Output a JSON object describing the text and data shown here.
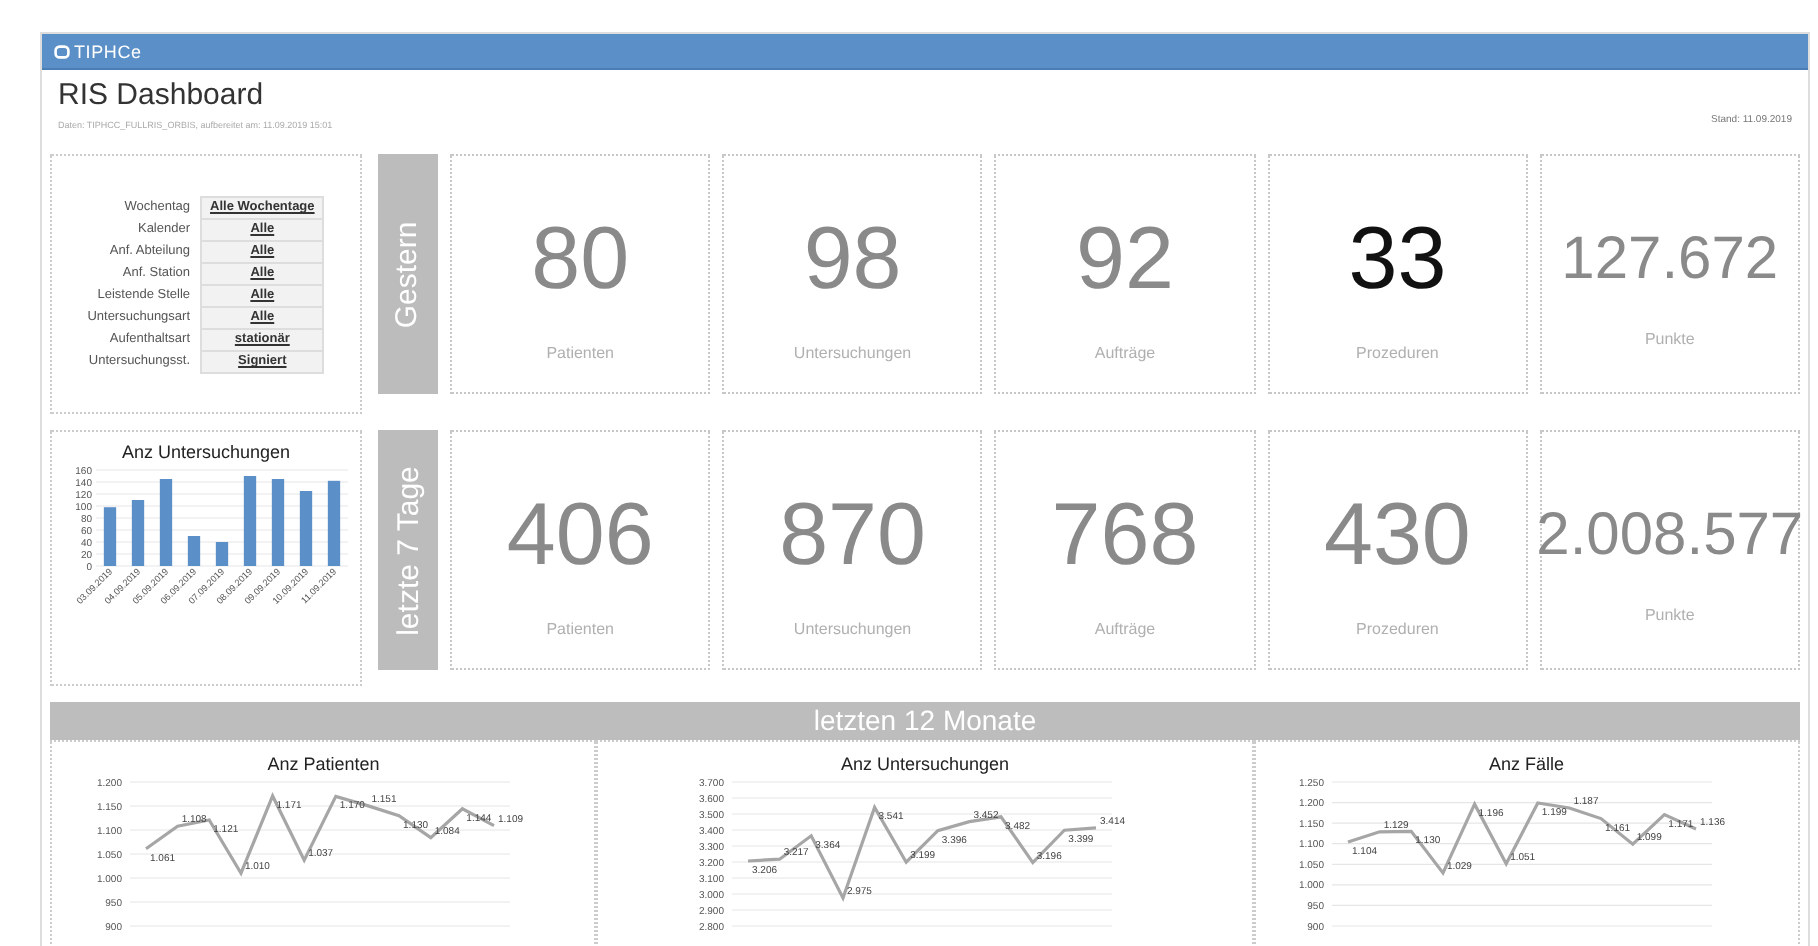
{
  "header": {
    "logo": "TIPHCe"
  },
  "title": "RIS Dashboard",
  "subtitle": "Daten: TIPHCC_FULLRIS_ORBIS, aufbereitet am: 11.09.2019 15:01",
  "stand": "Stand:  11.09.2019",
  "filters": [
    {
      "label": "Wochentag",
      "value": "Alle Wochentage"
    },
    {
      "label": "Kalender",
      "value": "Alle"
    },
    {
      "label": "Anf. Abteilung",
      "value": "Alle"
    },
    {
      "label": "Anf. Station",
      "value": "Alle"
    },
    {
      "label": "Leistende Stelle",
      "value": "Alle"
    },
    {
      "label": "Untersuchungsart",
      "value": "Alle"
    },
    {
      "label": "Aufenthaltsart",
      "value": "stationär"
    },
    {
      "label": "Untersuchungsst.",
      "value": "Signiert"
    }
  ],
  "gestern": {
    "label": "Gestern",
    "kpis": [
      {
        "value": "80",
        "label": "Patienten",
        "highlight": false
      },
      {
        "value": "98",
        "label": "Untersuchungen",
        "highlight": false
      },
      {
        "value": "92",
        "label": "Aufträge",
        "highlight": false
      },
      {
        "value": "33",
        "label": "Prozeduren",
        "highlight": true
      },
      {
        "value": "127.672",
        "label": "Punkte",
        "highlight": false
      }
    ]
  },
  "bar_chart": {
    "chart_data": {
      "type": "bar",
      "title": "Anz Untersuchungen",
      "categories": [
        "03.09.2019",
        "04.09.2019",
        "05.09.2019",
        "06.09.2019",
        "07.09.2019",
        "08.09.2019",
        "09.09.2019",
        "10.09.2019",
        "11.09.2019"
      ],
      "series": [
        {
          "color": "#5b8fc7",
          "values": [
            98,
            110,
            145,
            50,
            40,
            150,
            145,
            125,
            142
          ]
        }
      ],
      "grid": true,
      "ylim": [
        0,
        160
      ],
      "yticks": [
        0,
        20,
        40,
        60,
        80,
        100,
        120,
        140,
        160
      ]
    }
  },
  "letzte_7_tage": {
    "label": "letzte 7 Tage",
    "kpis": [
      {
        "value": "406",
        "label": "Patienten",
        "highlight": false
      },
      {
        "value": "870",
        "label": "Untersuchungen",
        "highlight": false
      },
      {
        "value": "768",
        "label": "Aufträge",
        "highlight": false
      },
      {
        "value": "430",
        "label": "Prozeduren",
        "highlight": false
      },
      {
        "value": "2.008.577",
        "label": "Punkte",
        "highlight": false
      }
    ]
  },
  "section_header": "letzten 12 Monate",
  "monthly_charts": [
    {
      "chart_data": {
        "type": "line",
        "title": "Anz Patienten",
        "grid": true,
        "series": [
          {
            "color": "#a6a6a6",
            "values": [
              1061,
              1108,
              1121,
              1010,
              1171,
              1037,
              1170,
              1151,
              1130,
              1084,
              1144,
              1109
            ]
          }
        ],
        "value_labels": [
          "1.061",
          "1.108",
          "1.121",
          "1.010",
          "1.171",
          "1.037",
          "1.170",
          "1.151",
          "1.130",
          "1.084",
          "1.144",
          "1.109"
        ],
        "ylim": [
          900,
          1200
        ],
        "yticks": [
          {
            "value": 900,
            "label": "900"
          },
          {
            "value": 950,
            "label": "950"
          },
          {
            "value": 1000,
            "label": "1.000"
          },
          {
            "value": 1050,
            "label": "1.050"
          },
          {
            "value": 1100,
            "label": "1.100"
          },
          {
            "value": 1150,
            "label": "1.150"
          },
          {
            "value": 1200,
            "label": "1.200"
          }
        ]
      }
    },
    {
      "chart_data": {
        "type": "line",
        "title": "Anz Untersuchungen",
        "grid": true,
        "series": [
          {
            "color": "#a6a6a6",
            "values": [
              3206,
              3217,
              3364,
              2975,
              3541,
              3199,
              3396,
              3452,
              3482,
              3196,
              3399,
              3414
            ]
          }
        ],
        "value_labels": [
          "3.206",
          "3.217",
          "3.364",
          "2.975",
          "3.541",
          "3.199",
          "3.396",
          "3.452",
          "3.482",
          "3.196",
          "3.399",
          "3.414"
        ],
        "ylim": [
          2800,
          3700
        ],
        "yticks": [
          {
            "value": 2800,
            "label": "2.800"
          },
          {
            "value": 2900,
            "label": "2.900"
          },
          {
            "value": 3000,
            "label": "3.000"
          },
          {
            "value": 3100,
            "label": "3.100"
          },
          {
            "value": 3200,
            "label": "3.200"
          },
          {
            "value": 3300,
            "label": "3.300"
          },
          {
            "value": 3400,
            "label": "3.400"
          },
          {
            "value": 3500,
            "label": "3.500"
          },
          {
            "value": 3600,
            "label": "3.600"
          },
          {
            "value": 3700,
            "label": "3.700"
          }
        ]
      }
    },
    {
      "chart_data": {
        "type": "line",
        "title": "Anz Fälle",
        "grid": true,
        "series": [
          {
            "color": "#a6a6a6",
            "values": [
              1104,
              1129,
              1130,
              1029,
              1196,
              1051,
              1199,
              1187,
              1161,
              1099,
              1171,
              1136
            ]
          }
        ],
        "value_labels": [
          "1.104",
          "1.129",
          "1.130",
          "1.029",
          "1.196",
          "1.051",
          "1.199",
          "1.187",
          "1.161",
          "1.099",
          "1.171",
          "1.136"
        ],
        "ylim": [
          900,
          1250
        ],
        "yticks": [
          {
            "value": 900,
            "label": "900"
          },
          {
            "value": 950,
            "label": "950"
          },
          {
            "value": 1000,
            "label": "1.000"
          },
          {
            "value": 1050,
            "label": "1.050"
          },
          {
            "value": 1100,
            "label": "1.100"
          },
          {
            "value": 1150,
            "label": "1.150"
          },
          {
            "value": 1200,
            "label": "1.200"
          },
          {
            "value": 1250,
            "label": "1.250"
          }
        ]
      }
    }
  ]
}
